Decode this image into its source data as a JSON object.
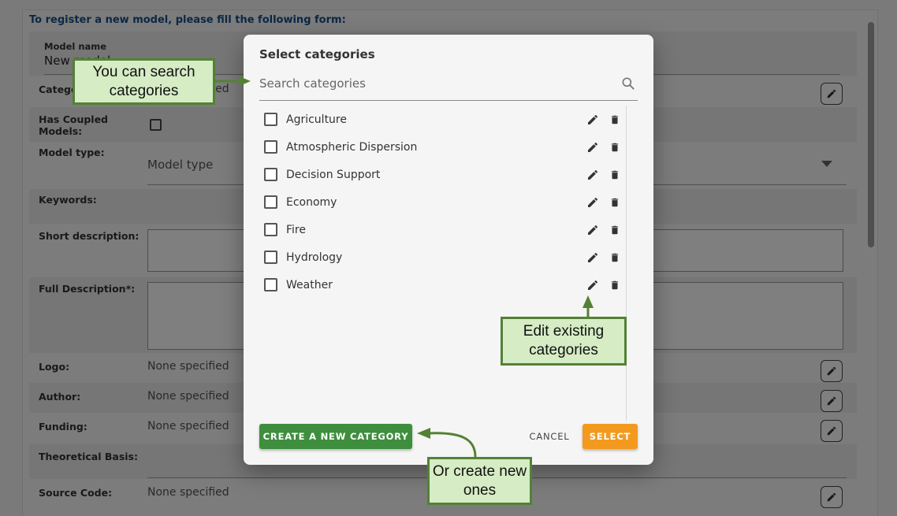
{
  "form": {
    "intro": "To register a new model, please fill the following form:",
    "model_name_label": "Model name",
    "model_name_value": "New model",
    "categories_label": "Categories:",
    "categories_value": "None specified",
    "coupled_label": "Has Coupled Models:",
    "model_type_label": "Model type:",
    "model_type_placeholder": "Model type",
    "keywords_label": "Keywords:",
    "short_desc_label": "Short description:",
    "full_desc_label": "Full Description*:",
    "logo_label": "Logo:",
    "logo_value": "None specified",
    "author_label": "Author:",
    "author_value": "None specified",
    "funding_label": "Funding:",
    "funding_value": "None specified",
    "theoretical_label": "Theoretical Basis:",
    "source_label": "Source Code:",
    "source_value": "None specified"
  },
  "modal": {
    "title": "Select categories",
    "search_placeholder": "Search categories",
    "categories": [
      {
        "label": "Agriculture"
      },
      {
        "label": "Atmospheric Dispersion"
      },
      {
        "label": "Decision Support"
      },
      {
        "label": "Economy"
      },
      {
        "label": "Fire"
      },
      {
        "label": "Hydrology"
      },
      {
        "label": "Weather"
      }
    ],
    "create_label": "CREATE A NEW CATEGORY",
    "cancel_label": "CANCEL",
    "select_label": "SELECT"
  },
  "callouts": {
    "search": "You can search categories",
    "edit": "Edit existing categories",
    "create": "Or create new ones"
  },
  "colors": {
    "create_button": "#3e8e3e",
    "select_button": "#f39a1e",
    "callout_fill": "#d5ecc4",
    "callout_border": "#538135"
  }
}
